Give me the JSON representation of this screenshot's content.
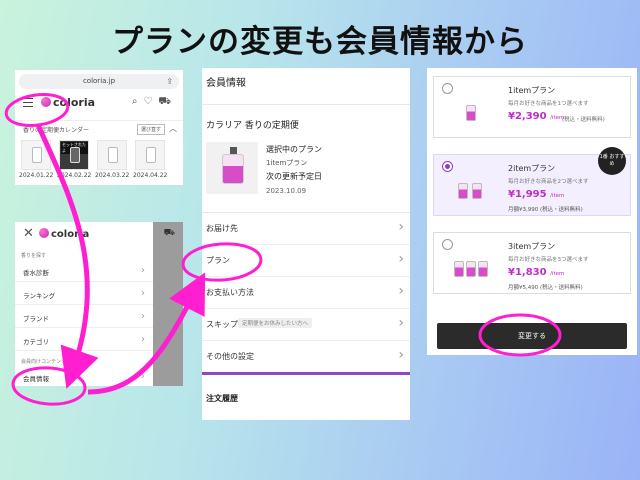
{
  "headline": "プランの変更も会員情報から",
  "colors": {
    "accent_magenta": "#ff1fd0",
    "brand_pink": "#c02bc9",
    "accent_purple": "#8e48c7"
  },
  "panel_a": {
    "url": "coloria.jp",
    "logo_text": "coloria",
    "icons": [
      "share-icon",
      "menu-icon",
      "search-icon",
      "heart-icon",
      "cart-icon"
    ],
    "calendar_title": "香りの定期便カレンダー",
    "calendar_button": "選び直す",
    "selected_tag": "セットされたよ",
    "dates": [
      "2024.01.22",
      "2024.02.22",
      "2024.03.22",
      "2024.04.22"
    ]
  },
  "panel_b": {
    "logo_text": "coloria",
    "section_1": "香りを探す",
    "items_1": [
      "香水診断",
      "ランキング",
      "ブランド",
      "カテゴリ"
    ],
    "section_2": "会員向けコンテンツ",
    "items_2": [
      "会員情報"
    ]
  },
  "panel_c": {
    "title": "会員情報",
    "subscription_title": "カラリア 香りの定期便",
    "current_plan_label": "選択中のプラン",
    "current_plan_name": "1itemプラン",
    "next_update_label": "次の更新予定日",
    "next_update_date": "2023.10.09",
    "rows": [
      "お届け先",
      "プラン",
      "お支払い方法",
      "スキップ",
      "その他の設定"
    ],
    "skip_hint": "定期便をお休みしたい方へ",
    "order_history": "注文履歴"
  },
  "panel_d": {
    "plans": [
      {
        "name": "1itemプラン",
        "desc": "毎月お好きな商品を1つ選べます",
        "price": "¥2,390",
        "unit": "/item",
        "tax": "(税込・送料無料)",
        "monthly": "",
        "selected": false
      },
      {
        "name": "2itemプラン",
        "desc": "毎月お好きな商品を2つ選べます",
        "price": "¥1,995",
        "unit": "/item",
        "tax": "",
        "monthly": "月額¥3,990 (税込・送料無料)",
        "selected": true
      },
      {
        "name": "3itemプラン",
        "desc": "毎月お好きな商品を3つ選べます",
        "price": "¥1,830",
        "unit": "/item",
        "tax": "",
        "monthly": "月額¥5,490 (税込・送料無料)",
        "selected": false
      }
    ],
    "badge": "1番 おすすめ",
    "change_button": "変更する"
  }
}
